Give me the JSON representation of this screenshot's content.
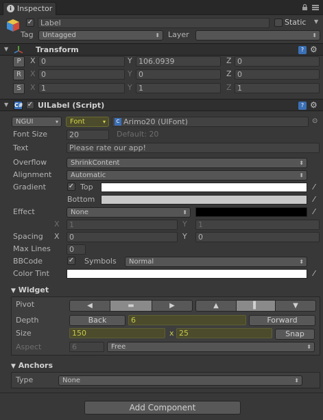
{
  "tab": {
    "title": "Inspector"
  },
  "object": {
    "name": "Label",
    "static_label": "Static",
    "tag_label": "Tag",
    "tag_value": "Untagged",
    "layer_label": "Layer",
    "layer_value": ""
  },
  "transform": {
    "title": "Transform",
    "p_btn": "P",
    "r_btn": "R",
    "s_btn": "S",
    "x": "X",
    "y": "Y",
    "z": "Z",
    "position": [
      "0",
      "106.0939",
      "0"
    ],
    "rotation": [
      "0",
      "0",
      "0"
    ],
    "scale": [
      "1",
      "1",
      "1"
    ]
  },
  "uilabel": {
    "title": "UILabel (Script)",
    "font_type": "NGUI",
    "font_btn": "Font",
    "font_value": "Arimo20 (UIFont)",
    "font_size_label": "Font Size",
    "font_size": "20",
    "default_text": "Default: 20",
    "text_label": "Text",
    "text_value": "Please rate our app!",
    "overflow_label": "Overflow",
    "overflow_value": "ShrinkContent",
    "alignment_label": "Alignment",
    "alignment_value": "Automatic",
    "gradient_label": "Gradient",
    "top_label": "Top",
    "bottom_label": "Bottom",
    "effect_label": "Effect",
    "effect_value": "None",
    "effect_x": "1",
    "effect_y": "1",
    "spacing_label": "Spacing",
    "spacing_x": "0",
    "spacing_y": "0",
    "max_lines_label": "Max Lines",
    "max_lines": "0",
    "bbcode_label": "BBCode",
    "symbols_label": "Symbols",
    "symbols_value": "Normal",
    "color_tint_label": "Color Tint",
    "colors": {
      "top": "#ffffff",
      "bottom": "#c8c8c8",
      "effect": "#000000",
      "tint": "#ffffff"
    }
  },
  "widget": {
    "title": "Widget",
    "pivot_label": "Pivot",
    "depth_label": "Depth",
    "back_btn": "Back",
    "depth_value": "6",
    "forward_btn": "Forward",
    "size_label": "Size",
    "width": "150",
    "x_sep": "x",
    "height": "25",
    "snap_btn": "Snap",
    "aspect_label": "Aspect",
    "aspect_value": "6",
    "aspect_mode": "Free"
  },
  "anchors": {
    "title": "Anchors",
    "type_label": "Type",
    "type_value": "None"
  },
  "add_component": "Add Component"
}
